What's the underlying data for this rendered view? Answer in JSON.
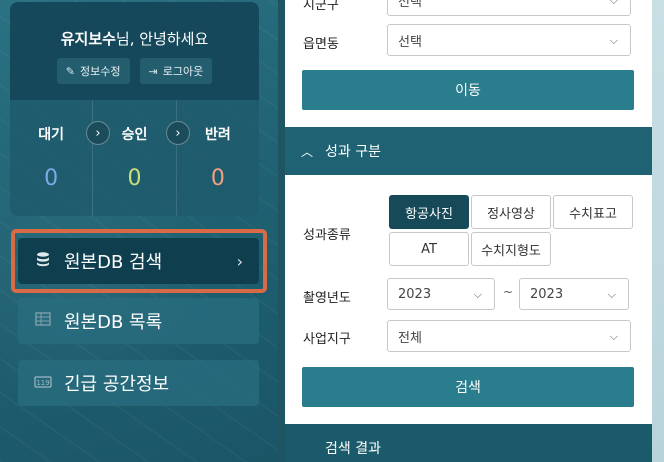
{
  "user": {
    "name": "유지보수",
    "greeting_suffix": "님, 안녕하세요",
    "edit_label": "정보수정",
    "logout_label": "로그아웃"
  },
  "status": {
    "items": [
      {
        "label": "대기",
        "count": "0",
        "color": "#7fa8e8"
      },
      {
        "label": "승인",
        "count": "0",
        "color": "#c8e07a"
      },
      {
        "label": "반려",
        "count": "0",
        "color": "#f0a080"
      }
    ]
  },
  "menu": {
    "items": [
      {
        "label": "원본DB 검색",
        "icon": "database-icon"
      },
      {
        "label": "원본DB 목록",
        "icon": "grid-list-icon"
      },
      {
        "label": "긴급 공간정보",
        "icon": "emergency-119-icon"
      }
    ]
  },
  "filter": {
    "sigungu_label": "시군구",
    "sigungu_value": "선택",
    "eupmyeondong_label": "읍면동",
    "eupmyeondong_value": "선택",
    "move_button": "이동"
  },
  "result_section": {
    "title": "성과 구분",
    "type_label": "성과종류",
    "types": [
      "항공사진",
      "정사영상",
      "수치표고",
      "AT",
      "수치지형도"
    ],
    "selected_type": "항공사진",
    "year_label": "촬영년도",
    "year_from": "2023",
    "year_to": "2023",
    "year_separator": "~",
    "district_label": "사업지구",
    "district_value": "전체",
    "search_button": "검색"
  },
  "search_results": {
    "title": "검색 결과"
  },
  "colors": {
    "highlight": "#d86a45",
    "primary": "#2a7d8d",
    "section": "#1e6273"
  }
}
